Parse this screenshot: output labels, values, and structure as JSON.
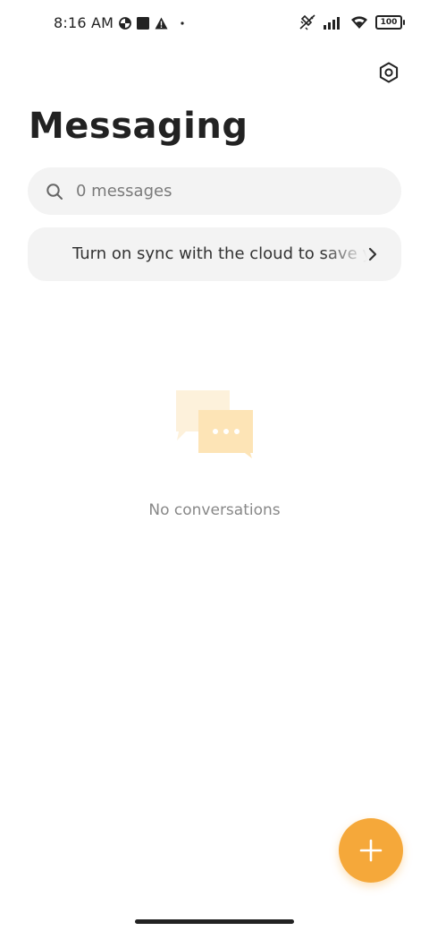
{
  "status_bar": {
    "time": "8:16 AM",
    "battery": "100",
    "icons": [
      "data-saver-icon",
      "square-notification-icon",
      "warning-icon",
      "dot-icon",
      "vibrate-off-icon",
      "signal-icon",
      "wifi-icon",
      "battery-icon"
    ]
  },
  "header": {
    "title": "Messaging",
    "settings_icon": "settings-hexagon-icon"
  },
  "search": {
    "placeholder": "0 messages",
    "icon": "search-icon"
  },
  "sync_banner": {
    "text": "Turn on sync with the cloud to save your messages",
    "icon": "chevron-right-icon"
  },
  "empty_state": {
    "illustration": "chat-bubbles-icon",
    "text": "No conversations"
  },
  "fab": {
    "icon": "plus-icon",
    "color": "#f5a83a"
  },
  "colors": {
    "accent": "#f5a83a",
    "surface": "#f3f3f3",
    "background": "#ffffff"
  }
}
